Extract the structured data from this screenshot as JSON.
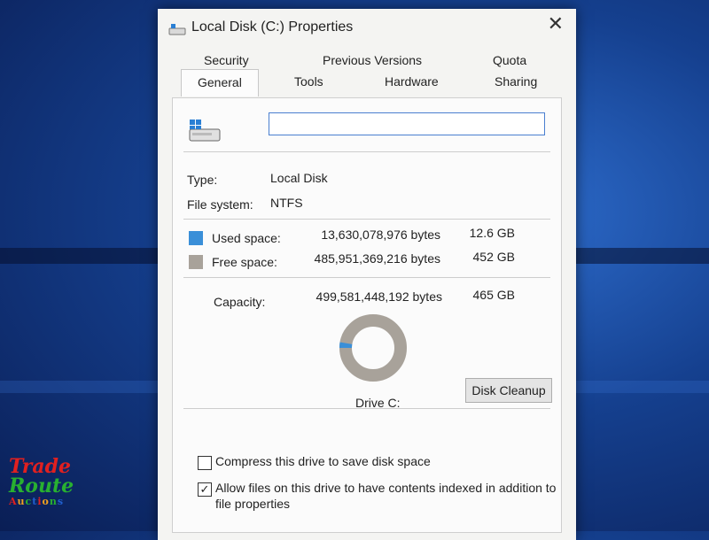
{
  "window": {
    "title": "Local Disk (C:) Properties",
    "close_glyph": "✕"
  },
  "tabs": {
    "back": [
      "Security",
      "Previous Versions",
      "Quota"
    ],
    "front": [
      "General",
      "Tools",
      "Hardware",
      "Sharing"
    ],
    "selected": "General"
  },
  "general": {
    "name_value": "",
    "type_label": "Type:",
    "type_value": "Local Disk",
    "fs_label": "File system:",
    "fs_value": "NTFS",
    "used_label": "Used space:",
    "used_bytes": "13,630,078,976 bytes",
    "used_gb": "12.6 GB",
    "free_label": "Free space:",
    "free_bytes": "485,951,369,216 bytes",
    "free_gb": "452 GB",
    "capacity_label": "Capacity:",
    "capacity_bytes": "499,581,448,192 bytes",
    "capacity_gb": "465 GB",
    "drive_label": "Drive C:",
    "cleanup_label": "Disk Cleanup",
    "compress_label": "Compress this drive to save disk space",
    "compress_checked": false,
    "index_label_line1": "Allow files on this drive to have contents indexed in addition to",
    "index_label_line2": "file properties",
    "index_checked": true
  },
  "usage": {
    "used_fraction": 0.0273,
    "used_color": "#3a8fd8",
    "free_color": "#a8a29a"
  },
  "watermark": {
    "line1": "Trade",
    "line2": "Route",
    "line3": "Auctions"
  },
  "icons": [
    "app-disk-icon",
    "drive-icon",
    "close-icon",
    "checkbox-icon"
  ]
}
